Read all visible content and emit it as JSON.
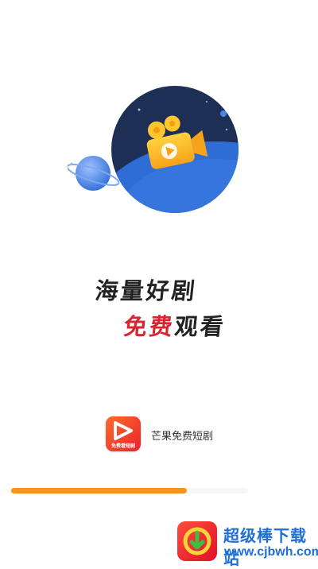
{
  "splash": {
    "slogan_line1": "海量好剧",
    "slogan_line2_red": "免费",
    "slogan_line2_black": "观看",
    "app_name": "芒果免费短剧",
    "app_logo_text": "免费看短剧",
    "progress": 0.74
  },
  "watermark": {
    "title": "超级棒下载站",
    "url": "www.cjbwh.com"
  },
  "colors": {
    "accent_orange": "#f7941d",
    "slogan_red": "#d7262f",
    "planet_dark": "#1d2f55",
    "planet_blue": "#2f6dd6",
    "watermark_blue": "#1e6fd9"
  },
  "icons": [
    "video-camera-icon",
    "play-icon",
    "planet-icon",
    "app-logo-icon",
    "download-site-logo-icon"
  ]
}
